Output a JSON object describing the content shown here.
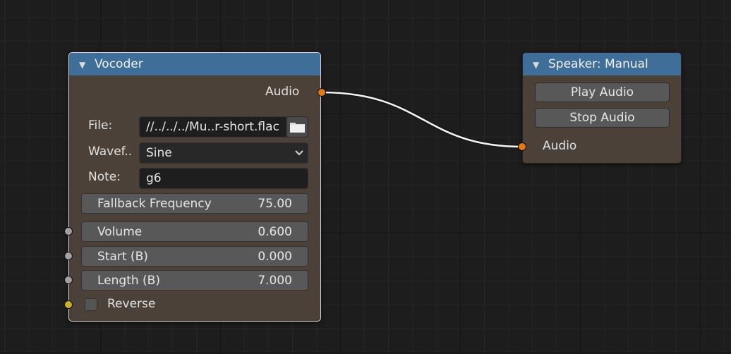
{
  "colors": {
    "header": "#3f6e99",
    "node_body": "#4c4138",
    "socket_audio": "#e07b1a",
    "socket_value": "#a1a1a1",
    "socket_bool": "#c9b12a",
    "link": "#ffffff"
  },
  "vocoder": {
    "title": "Vocoder",
    "output_socket": "Audio",
    "file_label": "File:",
    "file_value": "//../../../Mu..r-short.flac",
    "waveform_label": "Wavef..",
    "waveform_value": "Sine",
    "note_label": "Note:",
    "note_value": "g6",
    "fallback_label": "Fallback Frequency",
    "fallback_value": "75.00",
    "volume_label": "Volume",
    "volume_value": "0.600",
    "start_label": "Start (B)",
    "start_value": "0.000",
    "length_label": "Length (B)",
    "length_value": "7.000",
    "reverse_label": "Reverse"
  },
  "speaker": {
    "title": "Speaker: Manual",
    "play_label": "Play Audio",
    "stop_label": "Stop Audio",
    "input_socket": "Audio"
  }
}
